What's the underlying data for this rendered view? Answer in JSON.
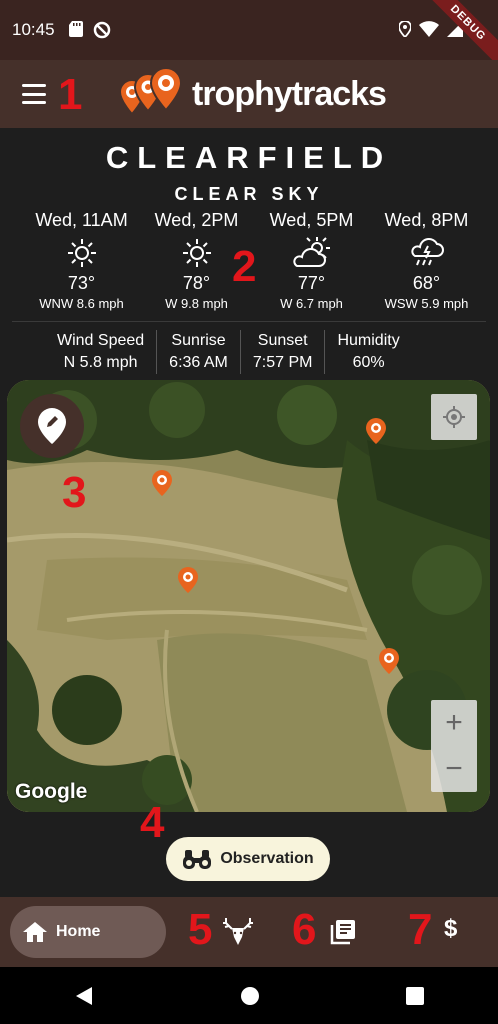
{
  "status_bar": {
    "time": "10:45",
    "debug_label": "DEBUG"
  },
  "app": {
    "name": "trophytracks"
  },
  "annotations": [
    "1",
    "2",
    "3",
    "4",
    "5",
    "6",
    "7"
  ],
  "weather": {
    "location": "CLEARFIELD",
    "condition": "CLEAR SKY",
    "forecast": [
      {
        "time": "Wed, 11AM",
        "icon": "sun-icon",
        "temp": "73°",
        "wind": "WNW 8.6 mph"
      },
      {
        "time": "Wed, 2PM",
        "icon": "sun-icon",
        "temp": "78°",
        "wind": "W 9.8 mph"
      },
      {
        "time": "Wed, 5PM",
        "icon": "partly-cloudy-icon",
        "temp": "77°",
        "wind": "W 6.7 mph"
      },
      {
        "time": "Wed, 8PM",
        "icon": "rain-cloud-icon",
        "temp": "68°",
        "wind": "WSW 5.9 mph"
      }
    ],
    "stats": [
      {
        "label": "Wind Speed",
        "value": "N 5.8 mph"
      },
      {
        "label": "Sunrise",
        "value": "6:36 AM"
      },
      {
        "label": "Sunset",
        "value": "7:57 PM"
      },
      {
        "label": "Humidity",
        "value": "60%"
      }
    ]
  },
  "map": {
    "attribution": "Google",
    "zoom_in": "+",
    "zoom_out": "−",
    "pin_color": "#e8641e"
  },
  "observation_button": {
    "label": "Observation"
  },
  "bottom_nav": {
    "home_label": "Home",
    "items": [
      "home-icon",
      "deer-icon",
      "journal-icon",
      "dollar-icon"
    ],
    "dollar_symbol": "$"
  },
  "colors": {
    "app_bar": "#45302a",
    "background": "#1e1e1e",
    "annotation_red": "#e2161b",
    "accent_orange": "#e8641e"
  }
}
